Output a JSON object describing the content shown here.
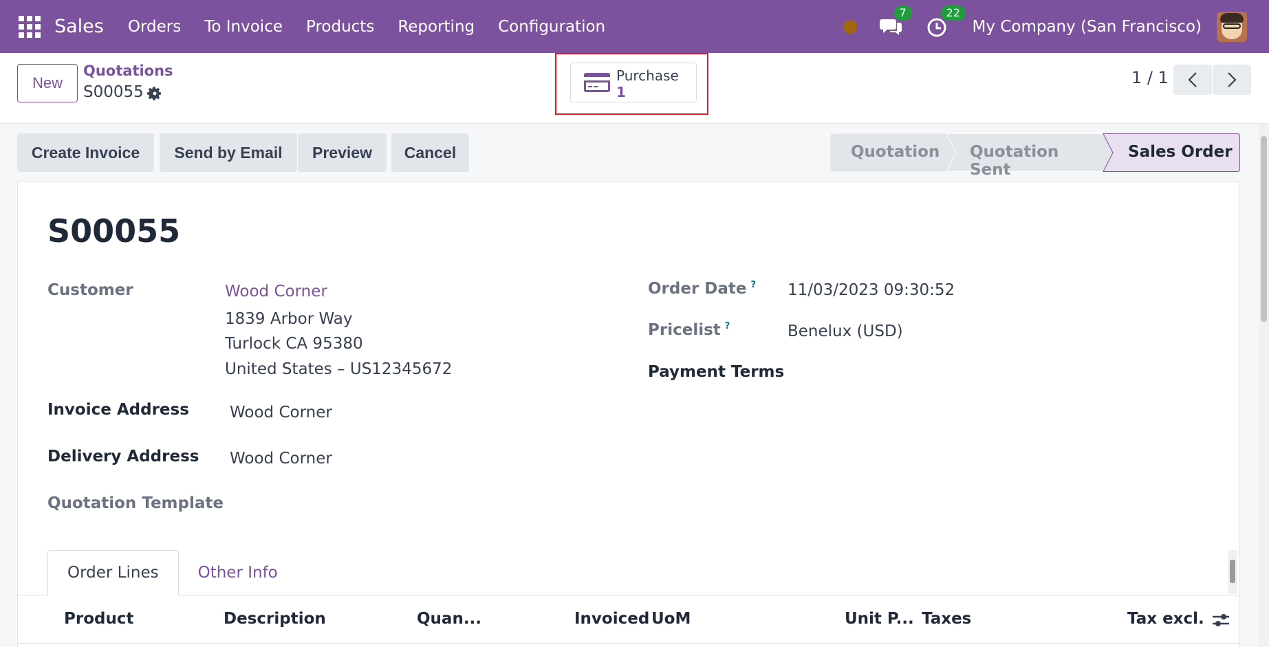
{
  "navbar": {
    "brand": "Sales",
    "menu": [
      "Orders",
      "To Invoice",
      "Products",
      "Reporting",
      "Configuration"
    ],
    "chat_count": "7",
    "activity_count": "22",
    "company": "My Company (San Francisco)",
    "color": "#7c519e"
  },
  "control": {
    "new_label": "New",
    "breadcrumb": "Quotations",
    "record_id": "S00055",
    "smart_button": {
      "label": "Purchase",
      "count": "1"
    },
    "pager": "1 / 1"
  },
  "actions": [
    "Create Invoice",
    "Send by Email",
    "Preview",
    "Cancel"
  ],
  "stages": {
    "items": [
      "Quotation",
      "Quotation Sent",
      "Sales Order"
    ],
    "active": "Sales Order"
  },
  "form": {
    "title": "S00055",
    "customer_label": "Customer",
    "customer_name": "Wood Corner",
    "customer_address": [
      "1839 Arbor Way",
      "Turlock CA 95380",
      "United States – US12345672"
    ],
    "invoice_address_label": "Invoice Address",
    "invoice_address": "Wood Corner",
    "delivery_address_label": "Delivery Address",
    "delivery_address": "Wood Corner",
    "quotation_template_label": "Quotation Template",
    "order_date_label": "Order Date",
    "order_date": "11/03/2023 09:30:52",
    "pricelist_label": "Pricelist",
    "pricelist": "Benelux (USD)",
    "payment_terms_label": "Payment Terms",
    "help_mark": "?"
  },
  "tabs": [
    "Order Lines",
    "Other Info"
  ],
  "table": {
    "columns": [
      "Product",
      "Description",
      "Quan...",
      "Invoiced",
      "UoM",
      "Unit P...",
      "Taxes",
      "Tax excl."
    ]
  }
}
